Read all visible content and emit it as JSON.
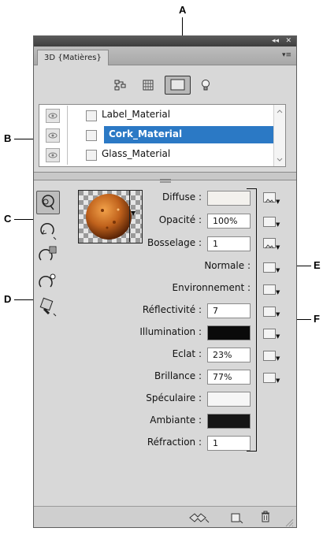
{
  "callouts": {
    "a": "A",
    "b": "B",
    "c": "C",
    "d": "D",
    "e": "E",
    "f": "F"
  },
  "panel": {
    "title": "3D {Matières}",
    "controls": {
      "collapse": "◂◂",
      "close": "✕",
      "menu": "▾≡"
    }
  },
  "filters": [
    "whole-scene-icon",
    "meshes-icon",
    "materials-icon",
    "lights-icon"
  ],
  "materials": [
    {
      "name": "Label_Material",
      "selected": false
    },
    {
      "name": "Cork_Material",
      "selected": true
    },
    {
      "name": "Glass_Material",
      "selected": false
    }
  ],
  "tools": [
    "select-material-tool-icon",
    "rotate-tool-icon",
    "drop-material-tool-icon",
    "light-rotate-tool-icon",
    "material-paint-tool-icon"
  ],
  "properties": {
    "diffuse": {
      "label": "Diffuse :",
      "color": "#f3f1ed"
    },
    "opacity": {
      "label": "Opacité :",
      "value": "100%"
    },
    "bump": {
      "label": "Bosselage :",
      "value": "1"
    },
    "normal": {
      "label": "Normale :"
    },
    "environment": {
      "label": "Environnement :"
    },
    "reflectivity": {
      "label": "Réflectivité :",
      "value": "7"
    },
    "illumination": {
      "label": "Illumination :",
      "color": "#0a0a0a"
    },
    "gloss": {
      "label": "Eclat :",
      "value": "23%"
    },
    "shine": {
      "label": "Brillance :",
      "value": "77%"
    },
    "specular": {
      "label": "Spéculaire :",
      "color": "#f6f6f6"
    },
    "ambient": {
      "label": "Ambiante :",
      "color": "#161616"
    },
    "refraction": {
      "label": "Réfraction :",
      "value": "1"
    }
  },
  "footer": [
    "render-settings-icon",
    "new-texture-icon",
    "delete-icon"
  ],
  "colors": {
    "selection": "#2b79c5",
    "panel": "#d8d8d8",
    "titlebar": "#3e3e3e"
  }
}
